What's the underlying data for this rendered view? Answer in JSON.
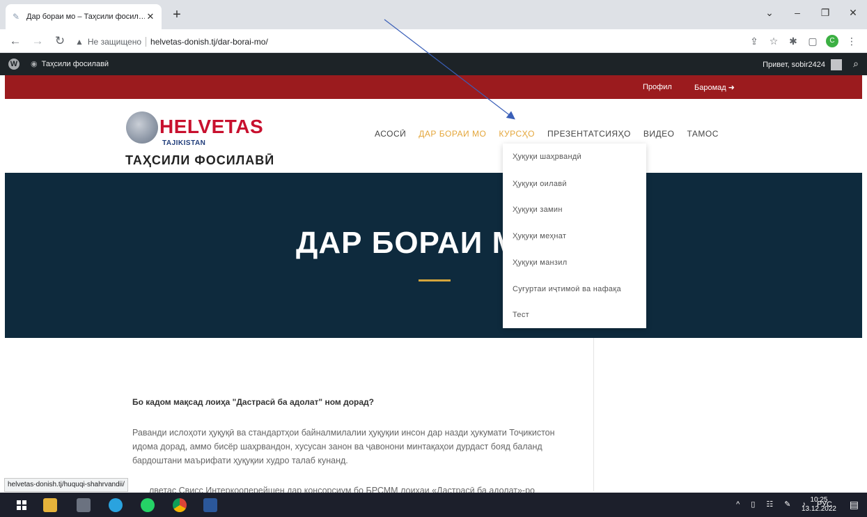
{
  "browser": {
    "tab_title": "Дар бораи мо – Таҳсили фосил…",
    "tab_close": "✕",
    "new_tab": "+",
    "security_label": "Не защищено",
    "url": "helvetas-donish.tj/dar-borai-mo/",
    "status_url": "helvetas-donish.tj/huquqi-shahrvandii/",
    "profile_letter": "C",
    "window_controls": [
      "⌄",
      "–",
      "❐",
      "✕"
    ]
  },
  "wpbar": {
    "site_name": "Таҳсили фосилавӣ",
    "greeting": "Привет, sobir2424"
  },
  "topbar": {
    "profile": "Профил",
    "logout": "Баромад"
  },
  "header": {
    "logo_main": "HELVETAS",
    "logo_sub": "TAJIKISTAN",
    "site_title": "ТАҲСИЛИ ФОСИЛАВӢ",
    "nav": [
      {
        "label": "АСОСӢ"
      },
      {
        "label": "ДАР БОРАИ МО"
      },
      {
        "label": "КУРСҲО"
      },
      {
        "label": "ПРЕЗЕНТАТСИЯҲО"
      },
      {
        "label": "ВИДЕО"
      },
      {
        "label": "ТАМОС"
      }
    ]
  },
  "hero": {
    "title": "ДАР БОРАИ МО"
  },
  "dropdown": {
    "items": [
      "Ҳуқуқи шаҳрвандӣ",
      "Ҳуқуқи оилавӣ",
      "Ҳуқуқи замин",
      "Ҳуқуқи меҳнат",
      "Ҳуқуқи манзил",
      "Суғуртаи иҷтимоӣ ва нафақа",
      "Тест"
    ]
  },
  "content": {
    "question": "Бо кадом мақсад лоиҳа \"Дастрасӣ ба адолат\" ном дорад?",
    "paragraph": "Раванди ислоҳоти ҳуқуқӣ ва стандартҳои байналмилалии ҳуқуқии инсон дар назди ҳукумати Тоҷикистон идома дорад, аммо бисёр шаҳрвандон, хусусан занон ва ҷавонони минтақаҳои дурдаст бояд баланд бардоштани маърифати ҳуқуқии худро талаб кунанд.",
    "paragraph2": "лветас Свисс Интеркооперейшен дар консорсиум бо БРСММ лоиҳаи «Дастрасӣ ба адолат»-ро"
  },
  "taskbar": {
    "lang": "РУС",
    "time": "10:25",
    "date": "13.12.2022"
  },
  "colors": {
    "red_bar": "#9b1b1e",
    "hero_bg": "#0e2a3d",
    "accent": "#e4a63a",
    "logo_red": "#c8102e"
  }
}
